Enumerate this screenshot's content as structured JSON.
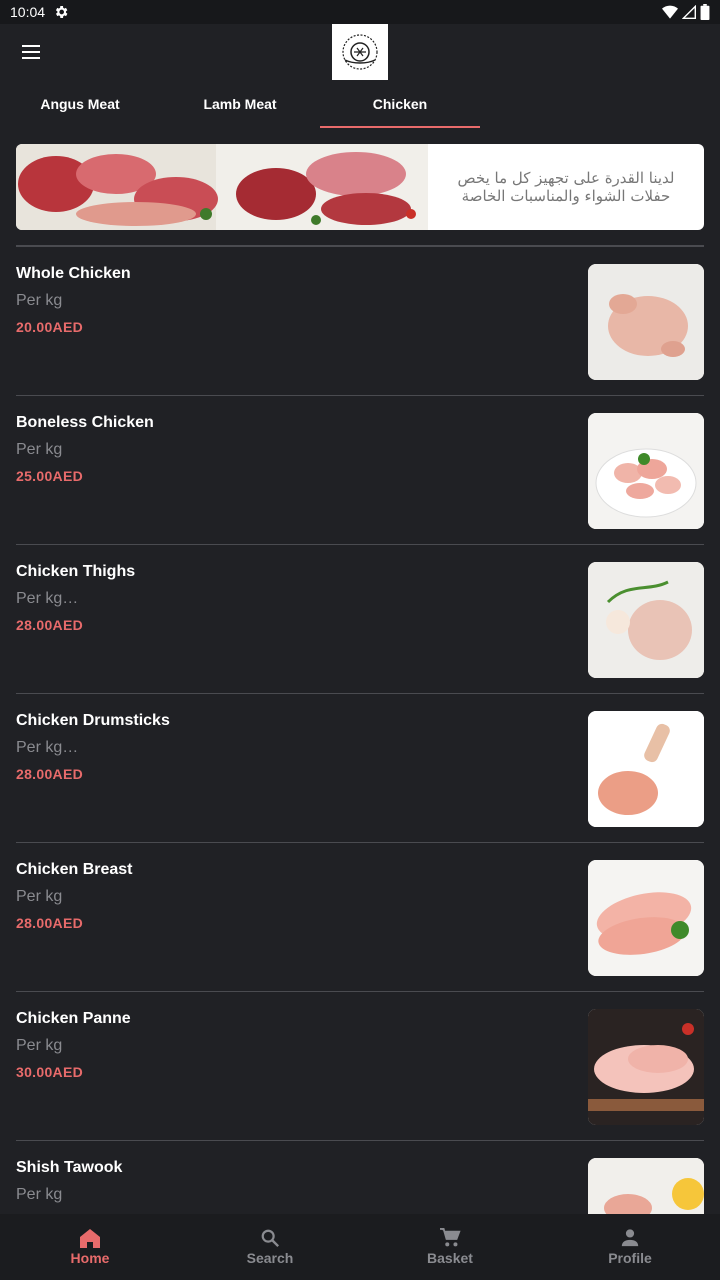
{
  "status_bar": {
    "time": "10:04"
  },
  "app_bar": {
    "menu_icon": "hamburger-menu-icon",
    "logo": "store-logo"
  },
  "tabs": [
    {
      "label": "Angus Meat",
      "active": false
    },
    {
      "label": "Lamb Meat",
      "active": false
    },
    {
      "label": "Chicken",
      "active": true
    }
  ],
  "banner": {
    "text": "لدينا القدرة على تجهيز كل ما يخص حفلات الشواء والمناسبات الخاصة"
  },
  "products": [
    {
      "name": "Whole Chicken",
      "unit": "Per kg",
      "price": "20.00AED"
    },
    {
      "name": "Boneless Chicken",
      "unit": "Per kg",
      "price": "25.00AED"
    },
    {
      "name": "Chicken Thighs",
      "unit": "Per kg…",
      "price": "28.00AED"
    },
    {
      "name": "Chicken Drumsticks",
      "unit": "Per kg…",
      "price": "28.00AED"
    },
    {
      "name": "Chicken Breast",
      "unit": "Per kg",
      "price": "28.00AED"
    },
    {
      "name": "Chicken Panne",
      "unit": "Per kg",
      "price": "30.00AED"
    },
    {
      "name": "Shish Tawook",
      "unit": "Per kg",
      "price": ""
    }
  ],
  "bottom_nav": [
    {
      "label": "Home",
      "icon": "home-icon",
      "active": true
    },
    {
      "label": "Search",
      "icon": "search-icon",
      "active": false
    },
    {
      "label": "Basket",
      "icon": "cart-icon",
      "active": false
    },
    {
      "label": "Profile",
      "icon": "person-icon",
      "active": false
    }
  ],
  "colors": {
    "accent": "#e86b6b",
    "background": "#202125",
    "muted": "#8a8b90"
  }
}
